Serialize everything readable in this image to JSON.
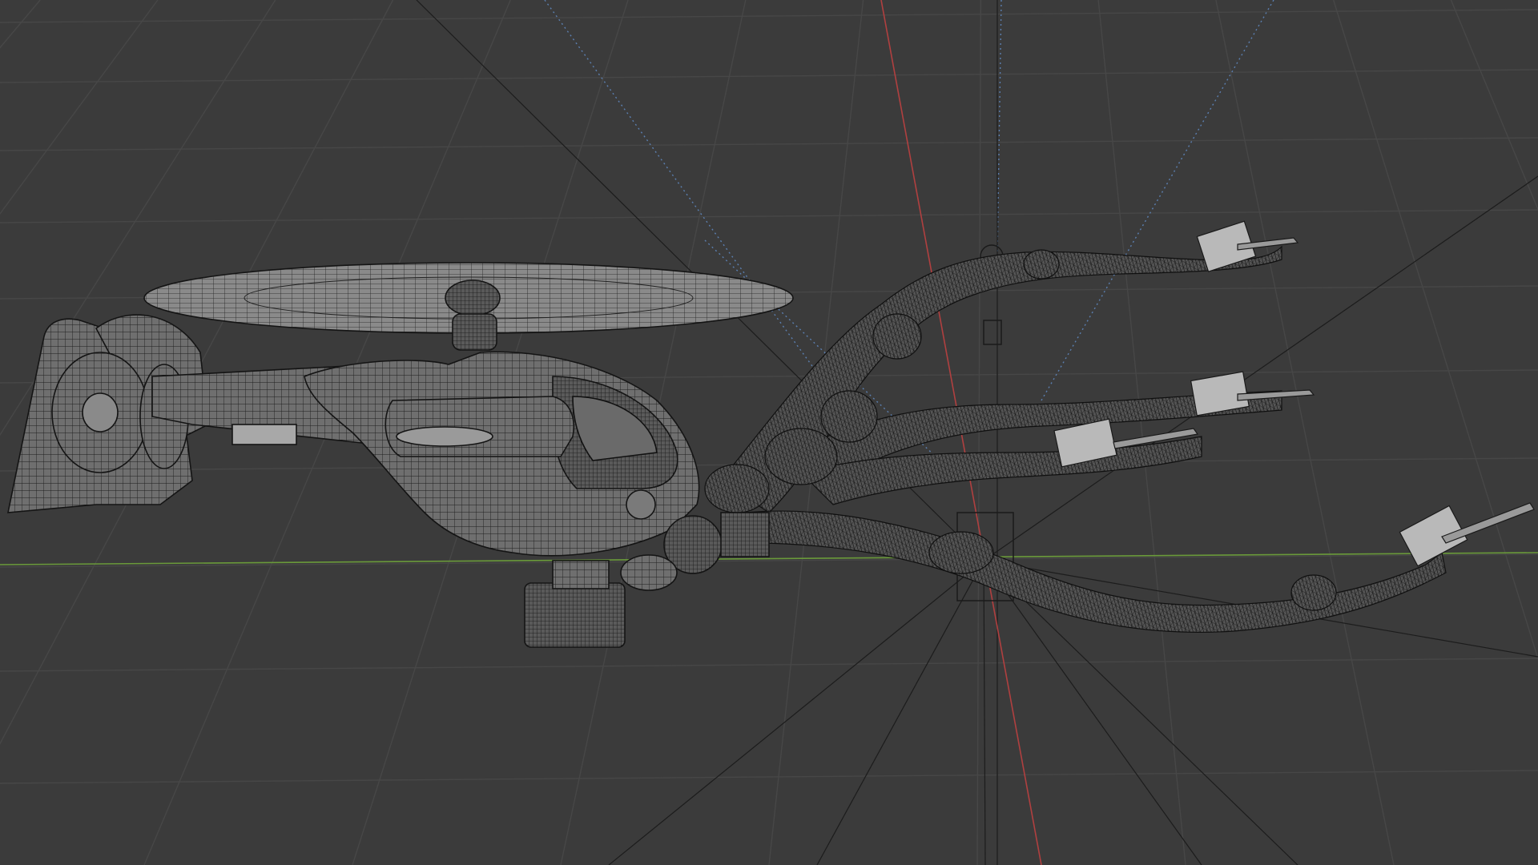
{
  "viewport": {
    "mode": "wireframe",
    "background_color": "#3b3b3b",
    "grid_color": "#4a4a4a",
    "wire_color": "#cfcfcf",
    "axis_x_color": "#b04040",
    "axis_y_color": "#6a9a3a",
    "guide_color": "#5b7fb0"
  },
  "objects": [
    {
      "name": "helicopter"
    },
    {
      "name": "smoke-trail",
      "count": 4
    },
    {
      "name": "missile",
      "count": 4
    }
  ]
}
